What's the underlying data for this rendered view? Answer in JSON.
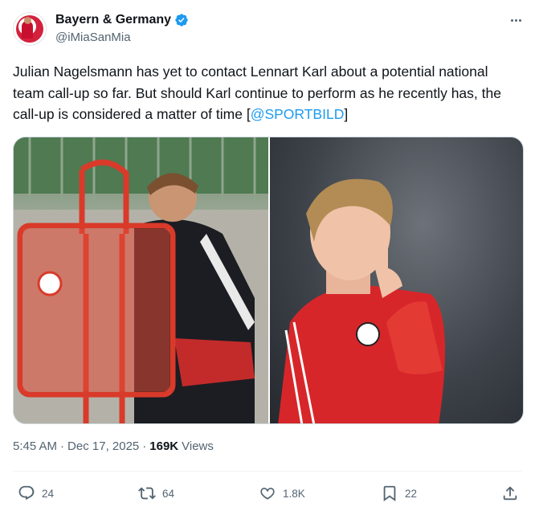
{
  "tweet": {
    "display_name": "Bayern & Germany",
    "handle": "@iMiaSanMia",
    "verified_icon": "verified-badge-icon",
    "text_before_mention": "Julian Nagelsmann has yet to contact Lennart Karl about a potential national team call-up so far. But should Karl continue to perform as he recently has, the call-up is considered a matter of time [",
    "mention": "@SPORTBILD",
    "text_after_mention": "]",
    "time": "5:45 AM",
    "dot": "·",
    "date": "Dec 17, 2025",
    "views_count": "169K",
    "views_label": "Views"
  },
  "actions": {
    "replies": "24",
    "reposts": "64",
    "likes": "1.8K",
    "bookmarks": "22"
  },
  "colors": {
    "accent": "#1d9bf0",
    "secondary_text": "#536471",
    "primary_text": "#0f1419"
  }
}
